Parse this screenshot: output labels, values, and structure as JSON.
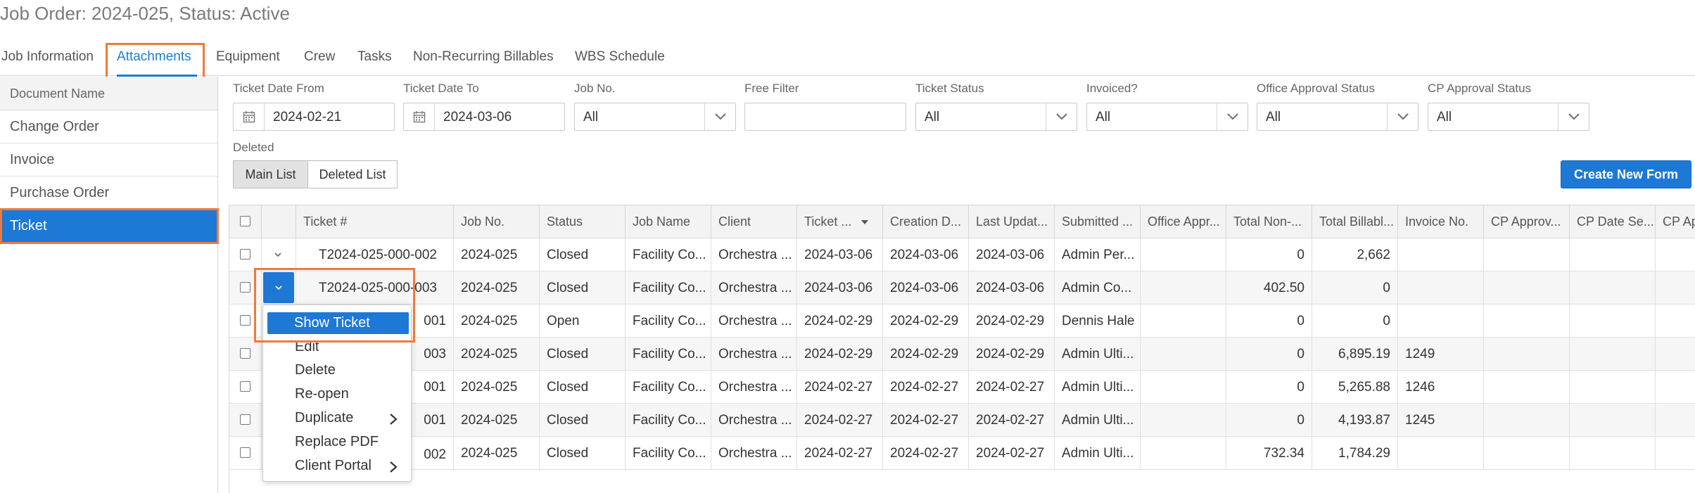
{
  "page": {
    "title": "Job Order: 2024-025, Status: Active"
  },
  "tabs": [
    {
      "label": "Job Information"
    },
    {
      "label": "Attachments"
    },
    {
      "label": "Equipment"
    },
    {
      "label": "Crew"
    },
    {
      "label": "Tasks"
    },
    {
      "label": "Non-Recurring Billables"
    },
    {
      "label": "WBS Schedule"
    }
  ],
  "active_tab": "Attachments",
  "documents": {
    "header": "Document Name",
    "items": [
      {
        "label": "Change Order"
      },
      {
        "label": "Invoice"
      },
      {
        "label": "Purchase Order"
      },
      {
        "label": "Ticket"
      }
    ],
    "selected": "Ticket"
  },
  "filters": {
    "ticket_date_from": {
      "label": "Ticket Date From",
      "value": "2024-02-21"
    },
    "ticket_date_to": {
      "label": "Ticket Date To",
      "value": "2024-03-06"
    },
    "job_no": {
      "label": "Job No.",
      "value": "All"
    },
    "free_filter": {
      "label": "Free Filter",
      "value": ""
    },
    "ticket_status": {
      "label": "Ticket Status",
      "value": "All"
    },
    "invoiced": {
      "label": "Invoiced?",
      "value": "All"
    },
    "office_approval": {
      "label": "Office Approval Status",
      "value": "All"
    },
    "cp_approval": {
      "label": "CP Approval Status",
      "value": "All"
    }
  },
  "deleted": {
    "label": "Deleted",
    "main_list": "Main List",
    "deleted_list": "Deleted List",
    "active": "Main List"
  },
  "create_button": "Create New Form",
  "table": {
    "columns": [
      "Ticket #",
      "Job No.",
      "Status",
      "Job Name",
      "Client",
      "Ticket ...",
      "Creation D...",
      "Last Updat...",
      "Submitted ...",
      "Office Appr...",
      "Total Non-...",
      "Total Billabl...",
      "Invoice No.",
      "CP Approv...",
      "CP Date Se...",
      "CP Ap"
    ],
    "sorted_column": "Ticket ...",
    "sort_direction": "descending",
    "rows": [
      [
        "T2024-025-000-002",
        "2024-025",
        "Closed",
        "Facility Co...",
        "Orchestra ...",
        "2024-03-06",
        "2024-03-06",
        "2024-03-06",
        "Admin Per...",
        "",
        "0",
        "2,662",
        "",
        "",
        "",
        ""
      ],
      [
        "T2024-025-000-003",
        "2024-025",
        "Closed",
        "Facility Co...",
        "Orchestra ...",
        "2024-03-06",
        "2024-03-06",
        "2024-03-06",
        "Admin Co...",
        "",
        "402.50",
        "0",
        "",
        "",
        "",
        ""
      ],
      [
        "001",
        "2024-025",
        "Open",
        "Facility Co...",
        "Orchestra ...",
        "2024-02-29",
        "2024-02-29",
        "2024-02-29",
        "Dennis Hale",
        "",
        "0",
        "0",
        "",
        "",
        "",
        ""
      ],
      [
        "003",
        "2024-025",
        "Closed",
        "Facility Co...",
        "Orchestra ...",
        "2024-02-29",
        "2024-02-29",
        "2024-02-29",
        "Admin Ulti...",
        "",
        "0",
        "6,895.19",
        "1249",
        "",
        "",
        ""
      ],
      [
        "001",
        "2024-025",
        "Closed",
        "Facility Co...",
        "Orchestra ...",
        "2024-02-27",
        "2024-02-27",
        "2024-02-27",
        "Admin Ulti...",
        "",
        "0",
        "5,265.88",
        "1246",
        "",
        "",
        ""
      ],
      [
        "001",
        "2024-025",
        "Closed",
        "Facility Co...",
        "Orchestra ...",
        "2024-02-27",
        "2024-02-27",
        "2024-02-27",
        "Admin Ulti...",
        "",
        "0",
        "4,193.87",
        "1245",
        "",
        "",
        ""
      ],
      [
        "002",
        "2024-025",
        "Closed",
        "Facility Co...",
        "Orchestra ...",
        "2024-02-27",
        "2024-02-27",
        "2024-02-27",
        "Admin Ulti...",
        "",
        "732.34",
        "1,784.29",
        "",
        "",
        "",
        ""
      ]
    ]
  },
  "context_menu": {
    "items": [
      {
        "label": "Show Ticket"
      },
      {
        "label": "Edit"
      },
      {
        "label": "Delete"
      },
      {
        "label": "Re-open"
      },
      {
        "label": "Duplicate"
      },
      {
        "label": "Replace PDF"
      },
      {
        "label": "Client Portal"
      }
    ]
  },
  "icons": {
    "calendar": "calendar-icon",
    "dropdown": "chevron-down-icon",
    "submenu": "chevron-right-icon",
    "sort": "sort-desc-icon"
  },
  "colors": {
    "accent": "#1e78d6",
    "highlight": "#f07a3a"
  }
}
